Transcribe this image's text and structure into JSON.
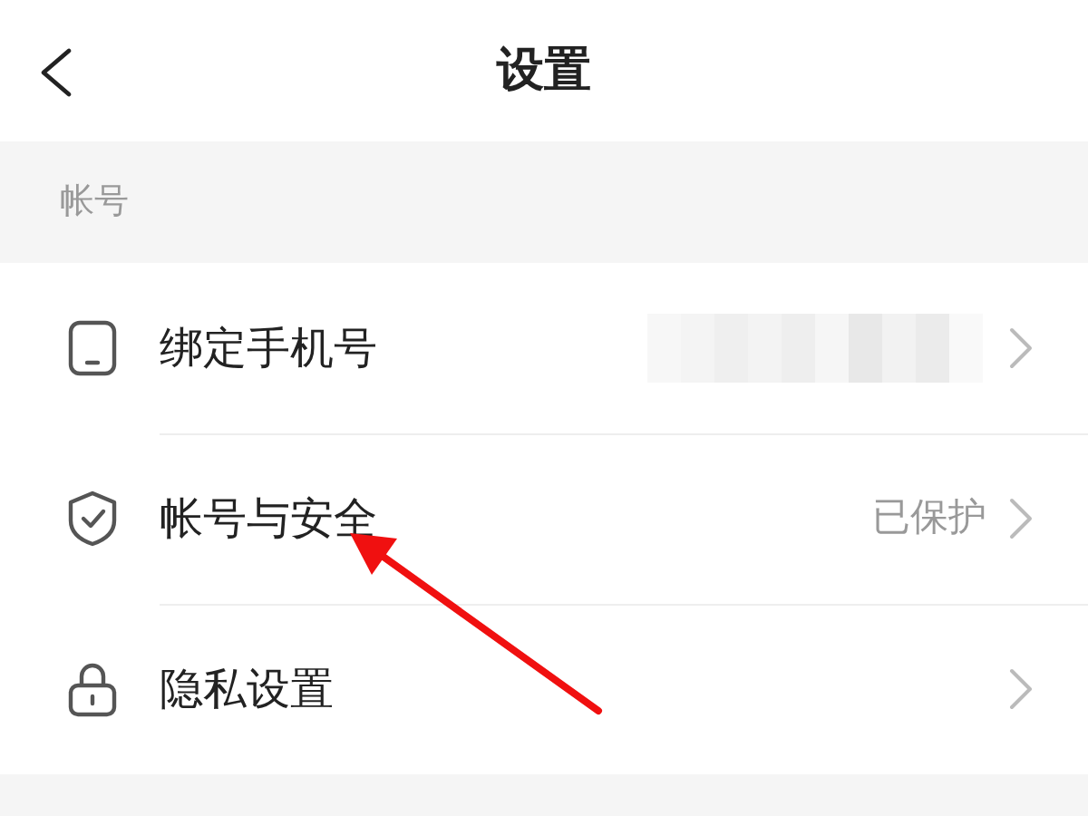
{
  "header": {
    "title": "设置"
  },
  "section": {
    "label": "帐号"
  },
  "items": [
    {
      "label": "绑定手机号",
      "value_redacted": true
    },
    {
      "label": "帐号与安全",
      "value": "已保护"
    },
    {
      "label": "隐私设置"
    }
  ],
  "annotation": {
    "kind": "arrow"
  }
}
